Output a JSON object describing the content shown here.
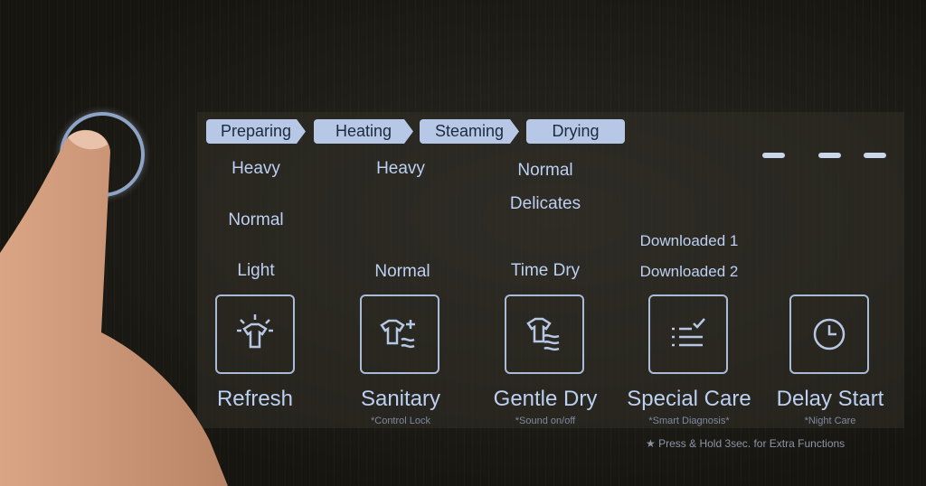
{
  "stages": [
    "Preparing",
    "Heating",
    "Steaming",
    "Drying"
  ],
  "columns": [
    {
      "courses": [
        "Heavy",
        "Normal",
        "Light"
      ],
      "label": "Refresh",
      "sub": "",
      "icon": "refresh-shirt-icon"
    },
    {
      "courses": [
        "Heavy",
        "Normal"
      ],
      "label": "Sanitary",
      "sub": "*Control Lock",
      "icon": "sanitary-shirt-icon"
    },
    {
      "courses": [
        "Normal",
        "Delicates",
        "Time Dry"
      ],
      "label": "Gentle Dry",
      "sub": "*Sound on/off",
      "icon": "gentle-dry-shirt-icon"
    },
    {
      "courses": [
        "Downloaded 1",
        "Downloaded 2"
      ],
      "label": "Special Care",
      "sub": "*Smart Diagnosis*",
      "icon": "checklist-icon"
    },
    {
      "courses": [],
      "label": "Delay Start",
      "sub": "*Night Care",
      "icon": "clock-icon"
    }
  ],
  "note": "★ Press & Hold 3sec. for Extra Functions",
  "display": "– – –",
  "colors": {
    "text": "#bcd0f2",
    "stage_bg": "#b7c8e6",
    "background": "#16140f"
  }
}
